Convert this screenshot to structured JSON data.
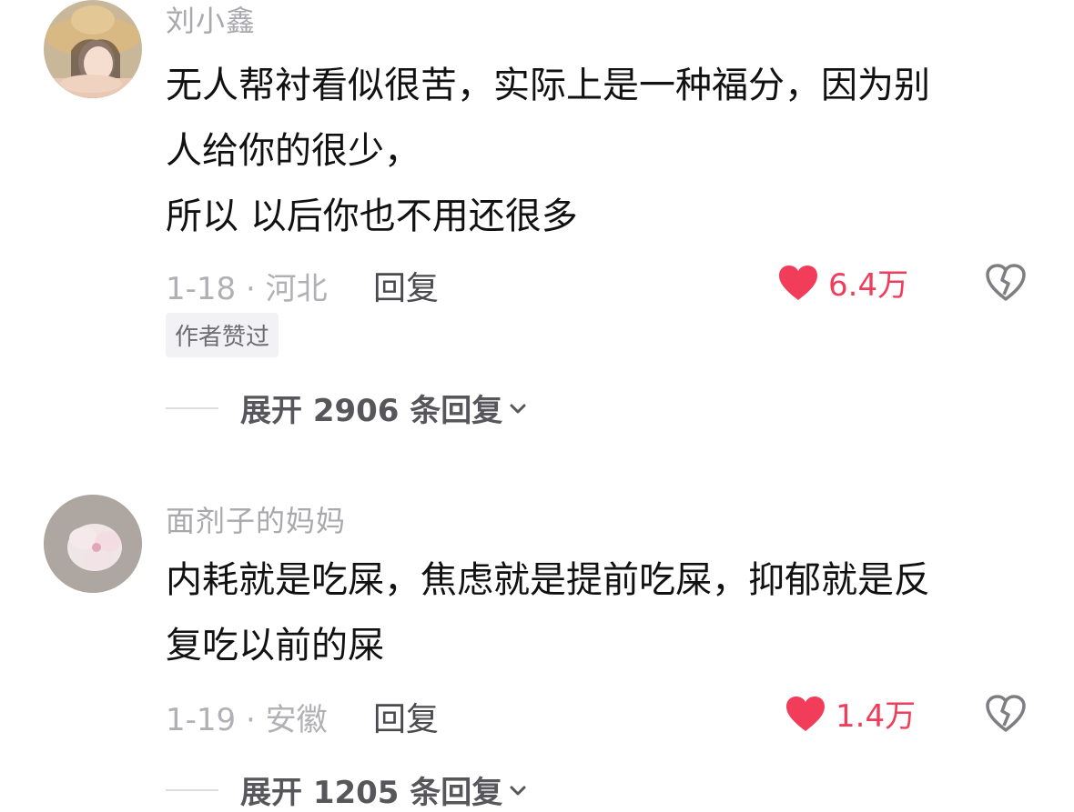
{
  "comments": [
    {
      "username": "刘小鑫",
      "lines": [
        "无人帮衬看似很苦，实际上是一种福分，因为别",
        "人给你的很少，",
        "所以 以后你也不用还很多"
      ],
      "date_location": "1-18 · 河北",
      "reply_label": "回复",
      "like_count": "6.4万",
      "badge": "作者赞过",
      "expand_label": "展开 2906 条回复"
    },
    {
      "username": "面剂子的妈妈",
      "lines": [
        "内耗就是吃屎，焦虑就是提前吃屎，抑郁就是反",
        "复吃以前的屎"
      ],
      "date_location": "1-19 · 安徽",
      "reply_label": "回复",
      "like_count": "1.4万",
      "expand_label": "展开 1205 条回复"
    }
  ],
  "colors": {
    "like": "#f23d5a",
    "meta": "#b0b0b5",
    "username": "#a8a8ad"
  }
}
